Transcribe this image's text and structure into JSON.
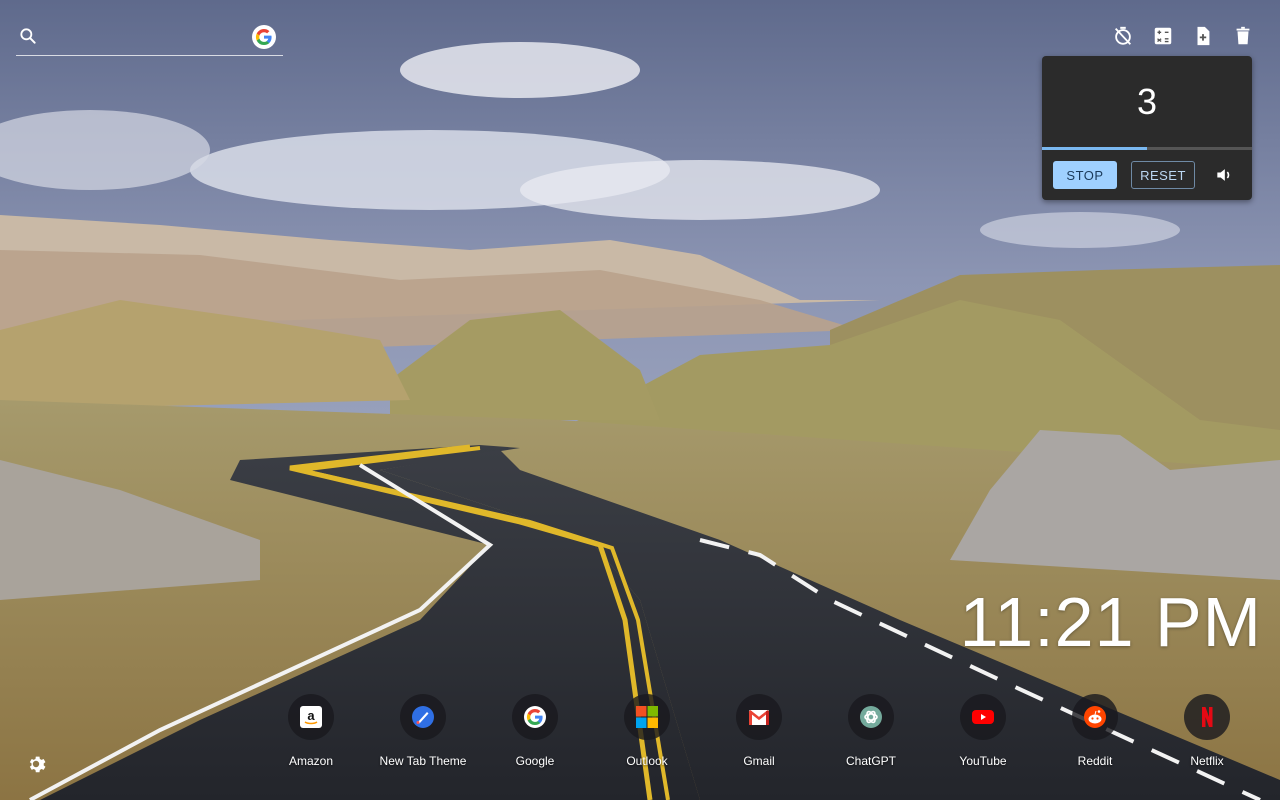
{
  "search": {
    "placeholder": "",
    "icon": "search-icon",
    "engine_icon": "google-g-icon"
  },
  "toolbar": {
    "buttons": [
      {
        "icon": "timer-off-icon"
      },
      {
        "icon": "calculator-icon"
      },
      {
        "icon": "add-note-icon"
      },
      {
        "icon": "trash-icon"
      }
    ]
  },
  "timer": {
    "count": "3",
    "progress": 0.5,
    "stop_label": "STOP",
    "reset_label": "RESET",
    "volume_icon": "volume-icon"
  },
  "clock": {
    "time": "11:21 PM"
  },
  "shortcuts": [
    {
      "label": "Amazon",
      "icon": "amazon-icon"
    },
    {
      "label": "New Tab Theme",
      "icon": "new-tab-theme-icon"
    },
    {
      "label": "Google",
      "icon": "google-icon"
    },
    {
      "label": "Outlook",
      "icon": "microsoft-icon"
    },
    {
      "label": "Gmail",
      "icon": "gmail-icon"
    },
    {
      "label": "ChatGPT",
      "icon": "chatgpt-icon"
    },
    {
      "label": "YouTube",
      "icon": "youtube-icon"
    },
    {
      "label": "Reddit",
      "icon": "reddit-icon"
    },
    {
      "label": "Netflix",
      "icon": "netflix-icon"
    }
  ],
  "settings": {
    "icon": "gear-icon"
  },
  "colors": {
    "sky": "#7d86a6",
    "timer_bg": "#2b2b2b",
    "stop_bg": "#9fd0ff",
    "progress": "#7ab8f0"
  }
}
